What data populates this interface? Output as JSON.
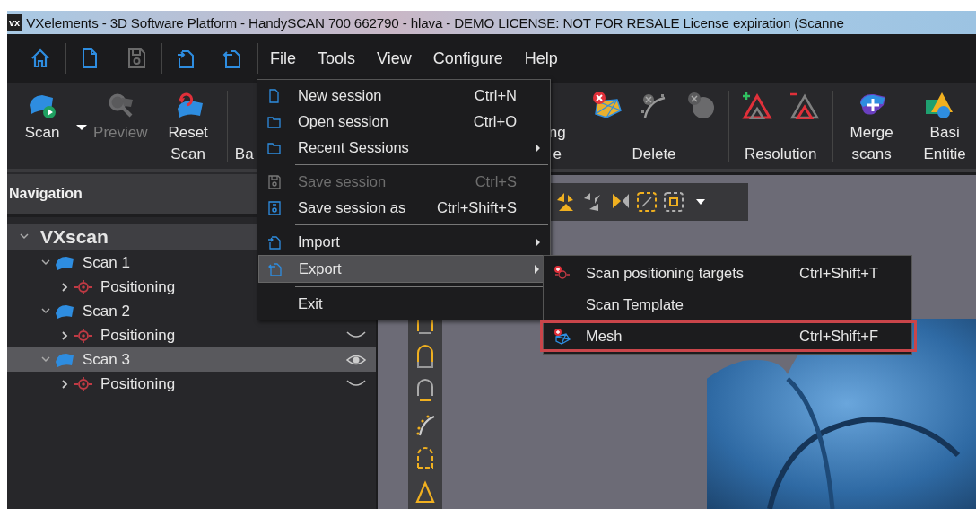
{
  "window": {
    "logo": "vx",
    "title": "VXelements - 3D Software Platform - HandySCAN 700 662790 - hlava - DEMO LICENSE: NOT FOR RESALE License expiration (Scanne"
  },
  "quick_tools": [
    {
      "kind": "home",
      "disabled": false
    },
    {
      "kind": "sep"
    },
    {
      "kind": "new",
      "disabled": false
    },
    {
      "kind": "save",
      "disabled": true
    },
    {
      "kind": "sep"
    },
    {
      "kind": "import",
      "disabled": false
    },
    {
      "kind": "export",
      "disabled": false
    },
    {
      "kind": "sep"
    }
  ],
  "menu_bar": [
    {
      "label": "File"
    },
    {
      "label": "Tools"
    },
    {
      "label": "View"
    },
    {
      "label": "Configure"
    },
    {
      "label": "Help"
    }
  ],
  "ribbon": [
    {
      "kind": "scan",
      "lines": [
        "Scan"
      ],
      "dropdown": true,
      "disabled": false
    },
    {
      "kind": "preview",
      "lines": [
        "Preview"
      ],
      "disabled": true
    },
    {
      "kind": "reset",
      "lines": [
        "Reset",
        "Scan"
      ],
      "disabled": false
    },
    {
      "kind": "sep"
    },
    {
      "kind": "partial-left",
      "lines": [
        "Ba"
      ]
    },
    {
      "kind": "partial-right",
      "lines": [
        "ng",
        "e"
      ]
    },
    {
      "kind": "sep"
    },
    {
      "kind": "delete",
      "lines": [
        "Delete"
      ]
    },
    {
      "kind": "sep"
    },
    {
      "kind": "resolution",
      "lines": [
        "Resolution"
      ]
    },
    {
      "kind": "sep"
    },
    {
      "kind": "merge",
      "lines": [
        "Merge",
        "scans"
      ],
      "disabled": false
    },
    {
      "kind": "sep"
    },
    {
      "kind": "basic",
      "lines": [
        "Basi",
        "Entitie"
      ],
      "disabled": false
    }
  ],
  "navigation": {
    "title": "Navigation",
    "tree": [
      {
        "label": "VXscan",
        "kind": "root",
        "expanded": true,
        "selected": false,
        "children": [
          {
            "label": "Scan 1",
            "kind": "scan",
            "expanded": true,
            "selected": false,
            "children": [
              {
                "label": "Positioning",
                "kind": "positioning",
                "expanded": false,
                "selected": false
              }
            ]
          },
          {
            "label": "Scan 2",
            "kind": "scan",
            "expanded": true,
            "selected": false,
            "children": [
              {
                "label": "Positioning",
                "kind": "positioning",
                "expanded": false,
                "selected": false,
                "visible": false
              }
            ]
          },
          {
            "label": "Scan 3",
            "kind": "scan",
            "expanded": true,
            "selected": true,
            "visible": true,
            "children": [
              {
                "label": "Positioning",
                "kind": "positioning",
                "expanded": false,
                "selected": false,
                "visible": false
              }
            ]
          }
        ]
      }
    ]
  },
  "file_menu": [
    {
      "kind": "new",
      "label": "New session",
      "shortcut": "Ctrl+N",
      "submenu": false,
      "disabled": false,
      "selected": false,
      "separator_after": false
    },
    {
      "kind": "open",
      "label": "Open session",
      "shortcut": "Ctrl+O",
      "submenu": false,
      "disabled": false,
      "selected": false,
      "separator_after": false
    },
    {
      "kind": "open",
      "label": "Recent Sessions",
      "submenu": true,
      "disabled": false,
      "selected": false,
      "separator_after": true
    },
    {
      "kind": "save",
      "label": "Save session",
      "shortcut": "Ctrl+S",
      "submenu": false,
      "disabled": true,
      "selected": false,
      "separator_after": false
    },
    {
      "kind": "saveas",
      "label": "Save session as",
      "shortcut": "Ctrl+Shift+S",
      "submenu": false,
      "disabled": false,
      "selected": false,
      "separator_after": true
    },
    {
      "kind": "import",
      "label": "Import",
      "submenu": true,
      "disabled": false,
      "selected": false,
      "separator_after": false
    },
    {
      "kind": "export",
      "label": "Export",
      "submenu": true,
      "disabled": false,
      "selected": true,
      "separator_after": true
    },
    {
      "kind": "plain",
      "label": "Exit",
      "submenu": false,
      "disabled": false,
      "selected": false,
      "separator_after": false
    }
  ],
  "export_menu": [
    {
      "kind": "targets",
      "label": "Scan positioning targets",
      "shortcut": "Ctrl+Shift+T",
      "highlighted": false
    },
    {
      "kind": "plain",
      "label": "Scan Template",
      "highlighted": false
    },
    {
      "kind": "mesh",
      "label": "Mesh",
      "shortcut": "Ctrl+Shift+F",
      "highlighted": true
    }
  ]
}
